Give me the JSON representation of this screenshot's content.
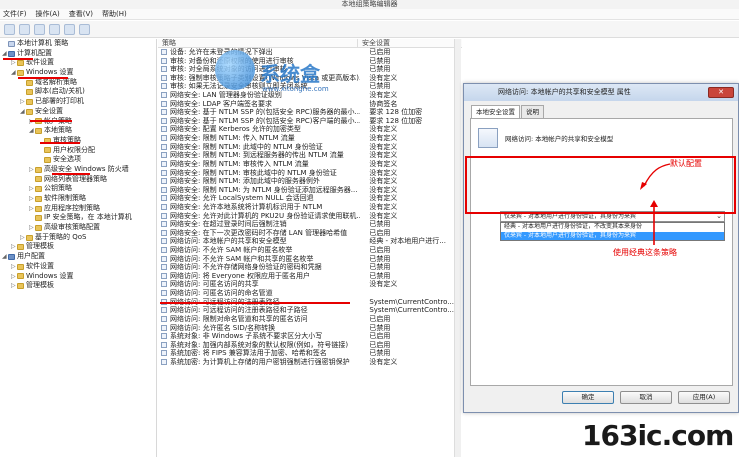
{
  "window": {
    "title": "本地组策略编辑器"
  },
  "menu": [
    "文件(F)",
    "操作(A)",
    "查看(V)",
    "帮助(H)"
  ],
  "tree": [
    {
      "label": "本地计算机 策略",
      "depth": 0,
      "icon": "policy",
      "toggle": ""
    },
    {
      "label": "计算机配置",
      "depth": 0,
      "icon": "pc",
      "toggle": "◢"
    },
    {
      "label": "软件设置",
      "depth": 1,
      "icon": "folder",
      "toggle": "▷"
    },
    {
      "label": "Windows 设置",
      "depth": 1,
      "icon": "folder",
      "toggle": "◢"
    },
    {
      "label": "域名解析策略",
      "depth": 2,
      "icon": "folder",
      "toggle": ""
    },
    {
      "label": "脚本(启动/关机)",
      "depth": 2,
      "icon": "folder",
      "toggle": ""
    },
    {
      "label": "已部署的打印机",
      "depth": 2,
      "icon": "folder",
      "toggle": "▷"
    },
    {
      "label": "安全设置",
      "depth": 2,
      "icon": "folder",
      "toggle": "◢"
    },
    {
      "label": "帐户策略",
      "depth": 3,
      "icon": "folder",
      "toggle": "▷"
    },
    {
      "label": "本地策略",
      "depth": 3,
      "icon": "folder",
      "toggle": "◢"
    },
    {
      "label": "审核策略",
      "depth": 4,
      "icon": "folder",
      "toggle": ""
    },
    {
      "label": "用户权限分配",
      "depth": 4,
      "icon": "folder",
      "toggle": ""
    },
    {
      "label": "安全选项",
      "depth": 4,
      "icon": "folder",
      "toggle": ""
    },
    {
      "label": "高级安全 Windows 防火墙",
      "depth": 3,
      "icon": "folder",
      "toggle": "▷"
    },
    {
      "label": "网络列表管理器策略",
      "depth": 3,
      "icon": "folder",
      "toggle": ""
    },
    {
      "label": "公钥策略",
      "depth": 3,
      "icon": "folder",
      "toggle": "▷"
    },
    {
      "label": "软件限制策略",
      "depth": 3,
      "icon": "folder",
      "toggle": "▷"
    },
    {
      "label": "应用程序控制策略",
      "depth": 3,
      "icon": "folder",
      "toggle": "▷"
    },
    {
      "label": "IP 安全策略，在 本地计算机",
      "depth": 3,
      "icon": "folder",
      "toggle": ""
    },
    {
      "label": "高级审核策略配置",
      "depth": 3,
      "icon": "folder",
      "toggle": "▷"
    },
    {
      "label": "基于策略的 QoS",
      "depth": 2,
      "icon": "folder",
      "toggle": "▷"
    },
    {
      "label": "管理模板",
      "depth": 1,
      "icon": "folder",
      "toggle": "▷"
    },
    {
      "label": "用户配置",
      "depth": 0,
      "icon": "pc",
      "toggle": "◢"
    },
    {
      "label": "软件设置",
      "depth": 1,
      "icon": "folder",
      "toggle": "▷"
    },
    {
      "label": "Windows 设置",
      "depth": 1,
      "icon": "folder",
      "toggle": "▷"
    },
    {
      "label": "管理模板",
      "depth": 1,
      "icon": "folder",
      "toggle": "▷"
    }
  ],
  "list": {
    "col_policy": "策略",
    "col_setting": "安全设置",
    "rows": [
      {
        "name": "设备: 允许在未登录的情况下弹出",
        "setting": "已启用"
      },
      {
        "name": "审核: 对备份和还原权限的使用进行审核",
        "setting": "已禁用"
      },
      {
        "name": "审核: 对全局系统对象的访问进行审核",
        "setting": "已禁用"
      },
      {
        "name": "审核: 强制审核策略子类别设置(Windows Vista 或更高版本)...",
        "setting": "没有定义"
      },
      {
        "name": "审核: 如果无法记录安全审核则立即关闭系统",
        "setting": "已禁用"
      },
      {
        "name": "网络安全: LAN 管理器身份验证级别",
        "setting": "没有定义"
      },
      {
        "name": "网络安全: LDAP 客户端签名要求",
        "setting": "协商签名"
      },
      {
        "name": "网络安全: 基于 NTLM SSP 的(包括安全 RPC)服务器的最小...",
        "setting": "要求 128 位加密"
      },
      {
        "name": "网络安全: 基于 NTLM SSP 的(包括安全 RPC)客户端的最小...",
        "setting": "要求 128 位加密"
      },
      {
        "name": "网络安全: 配置 Kerberos 允许的加密类型",
        "setting": "没有定义"
      },
      {
        "name": "网络安全: 限制 NTLM: 传入 NTLM 流量",
        "setting": "没有定义"
      },
      {
        "name": "网络安全: 限制 NTLM: 此域中的 NTLM 身份验证",
        "setting": "没有定义"
      },
      {
        "name": "网络安全: 限制 NTLM: 到远程服务器的传出 NTLM 流量",
        "setting": "没有定义"
      },
      {
        "name": "网络安全: 限制 NTLM: 审核传入 NTLM 流量",
        "setting": "没有定义"
      },
      {
        "name": "网络安全: 限制 NTLM: 审核此域中的 NTLM 身份验证",
        "setting": "没有定义"
      },
      {
        "name": "网络安全: 限制 NTLM: 添加此域中的服务器例外",
        "setting": "没有定义"
      },
      {
        "name": "网络安全: 限制 NTLM: 为 NTLM 身份验证添加远程服务器...",
        "setting": "没有定义"
      },
      {
        "name": "网络安全: 允许 LocalSystem NULL 会话回退",
        "setting": "没有定义"
      },
      {
        "name": "网络安全: 允许本地系统将计算机标识用于 NTLM",
        "setting": "没有定义"
      },
      {
        "name": "网络安全: 允许对此计算机的 PKU2U 身份验证请求使用联机...",
        "setting": "没有定义"
      },
      {
        "name": "网络安全: 在超过登录时间后强制注销",
        "setting": "已禁用"
      },
      {
        "name": "网络安全: 在下一次更改密码时不存储 LAN 管理器哈希值",
        "setting": "已启用"
      },
      {
        "name": "网络访问: 本地帐户的共享和安全模型",
        "setting": "经典 - 对本地用户进行..."
      },
      {
        "name": "网络访问: 不允许 SAM 帐户的匿名枚举",
        "setting": "已启用"
      },
      {
        "name": "网络访问: 不允许 SAM 帐户和共享的匿名枚举",
        "setting": "已禁用"
      },
      {
        "name": "网络访问: 不允许存储网络身份验证的密码和凭据",
        "setting": "已禁用"
      },
      {
        "name": "网络访问: 将 Everyone 权限应用于匿名用户",
        "setting": "已禁用"
      },
      {
        "name": "网络访问: 可匿名访问的共享",
        "setting": "没有定义"
      },
      {
        "name": "网络访问: 可匿名访问的命名管道",
        "setting": ""
      },
      {
        "name": "网络访问: 可远程访问的注册表路径",
        "setting": "System\\CurrentContro..."
      },
      {
        "name": "网络访问: 可远程访问的注册表路径和子路径",
        "setting": "System\\CurrentContro..."
      },
      {
        "name": "网络访问: 限制对命名管道和共享的匿名访问",
        "setting": "已启用"
      },
      {
        "name": "网络访问: 允许匿名 SID/名称转换",
        "setting": "已禁用"
      },
      {
        "name": "系统对象: 非 Windows 子系统不要求区分大小写",
        "setting": "已启用"
      },
      {
        "name": "系统对象: 加强内部系统对象的默认权限(例如，符号链接)",
        "setting": "已启用"
      },
      {
        "name": "系统加密: 将 FIPS 兼容算法用于加密、哈希和签名",
        "setting": "已禁用"
      },
      {
        "name": "系统加密: 为计算机上存储的用户密钥强制进行强密钥保护",
        "setting": "没有定义"
      }
    ]
  },
  "dialog": {
    "title": "网络访问: 本地帐户的共享和安全模型 属性",
    "close": "✕",
    "tabs": [
      "本地安全设置",
      "说明"
    ],
    "policy_name": "网络访问: 本地帐户的共享和安全模型",
    "combo_value": "仅来宾 - 对本地用户进行身份验证，其身份为来宾",
    "options": [
      "经典 - 对本地用户进行身份验证，不改变其本来身份",
      "仅来宾 - 对本地用户进行身份验证，其身份为来宾"
    ],
    "ok": "确定",
    "cancel": "取消",
    "apply": "应用(A)"
  },
  "annotations": {
    "default_config": "默认配置",
    "use_classic": "使用经典这条策略"
  },
  "watermarks": {
    "brand": "系统盒",
    "brand_url": "www.xitonghe.com",
    "site": "163ic.com"
  },
  "colors": {
    "annotation": "#e60000",
    "selection": "#3399ff"
  }
}
